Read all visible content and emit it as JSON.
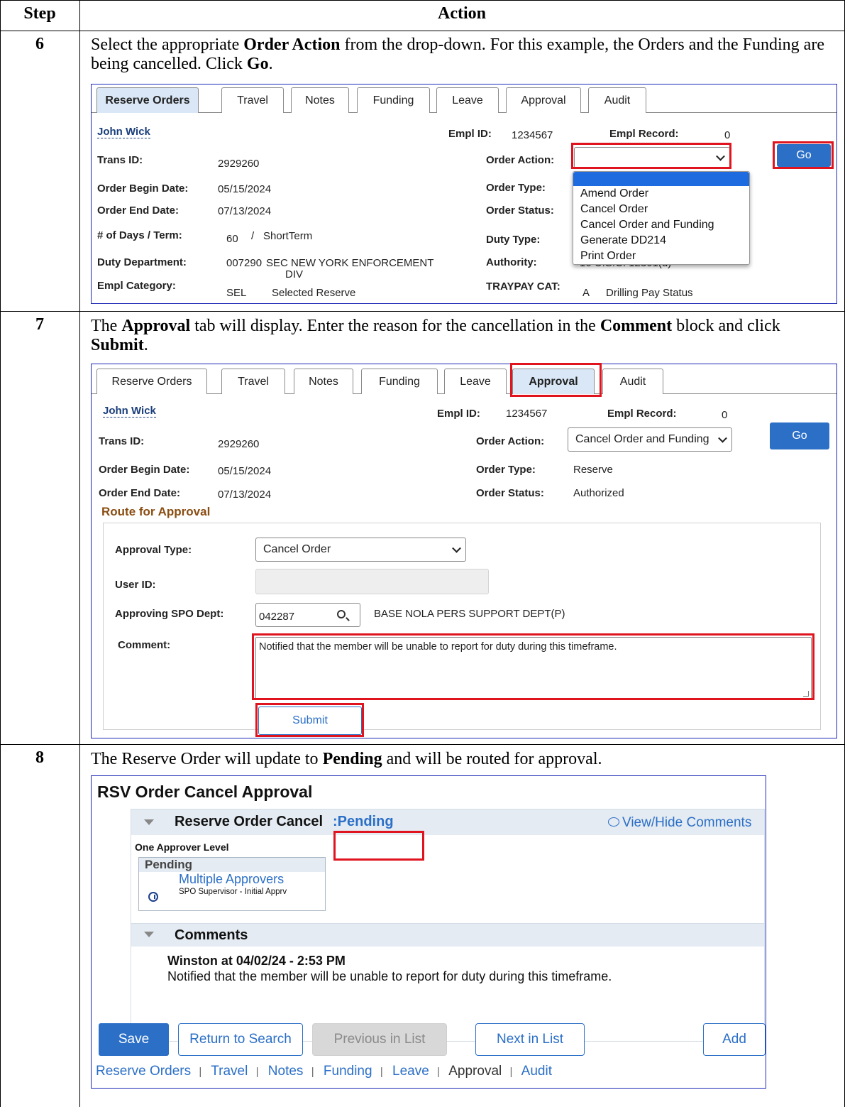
{
  "table": {
    "header_step": "Step",
    "header_action": "Action"
  },
  "step6": {
    "number": "6",
    "instr": {
      "t1": "Select the appropriate ",
      "b1": "Order Action",
      "t2": " from the drop-down. For this example, the Orders and the Funding are being cancelled. Click ",
      "b2": "Go",
      "t3": "."
    },
    "tabs": [
      "Reserve Orders",
      "Travel",
      "Notes",
      "Funding",
      "Leave",
      "Approval",
      "Audit"
    ],
    "name": "John Wick",
    "empl_id_label": "Empl ID:",
    "empl_id": "1234567",
    "empl_record_label": "Empl Record:",
    "empl_record": "0",
    "trans_id_label": "Trans ID:",
    "trans_id": "2929260",
    "order_action_label": "Order Action:",
    "order_action_value": "",
    "go_label": "Go",
    "begin_label": "Order Begin Date:",
    "begin": "05/15/2024",
    "end_label": "Order End Date:",
    "end": "07/13/2024",
    "type_label": "Order Type:",
    "status_label": "Order Status:",
    "days_label": "# of Days / Term:",
    "days": "60",
    "term_sep": "/",
    "term": "ShortTerm",
    "duty_type_label": "Duty Type:",
    "dept_label": "Duty Department:",
    "dept_code": "007290",
    "dept_name_1": "SEC NEW YORK ENFORCEMENT",
    "dept_name_2": "DIV",
    "authority_label": "Authority:",
    "authority_value": "10 U.S.C. 12301(d)",
    "category_label": "Empl Category:",
    "category_code": "SEL",
    "category_name": "Selected Reserve",
    "traypay_label": "TRAYPAY CAT:",
    "traypay_code": "A",
    "traypay_name": "Drilling Pay Status",
    "dropdown_options": [
      "Amend Order",
      "Cancel Order",
      "Cancel Order and Funding",
      "Generate DD214",
      "Print Order"
    ]
  },
  "step7": {
    "number": "7",
    "instr": {
      "t1": "The ",
      "b1": "Approval",
      "t2": " tab will display. Enter the reason for the cancellation in the ",
      "b2": "Comment",
      "t3": " block and click ",
      "b3": "Submit",
      "t4": "."
    },
    "tabs": [
      "Reserve Orders",
      "Travel",
      "Notes",
      "Funding",
      "Leave",
      "Approval",
      "Audit"
    ],
    "name": "John Wick",
    "empl_id_label": "Empl ID:",
    "empl_id": "1234567",
    "empl_record_label": "Empl Record:",
    "empl_record": "0",
    "trans_id_label": "Trans ID:",
    "trans_id": "2929260",
    "order_action_label": "Order Action:",
    "order_action_value": "Cancel Order and Funding",
    "go_label": "Go",
    "begin_label": "Order Begin Date:",
    "begin": "05/15/2024",
    "end_label": "Order End Date:",
    "end": "07/13/2024",
    "type_label": "Order Type:",
    "type": "Reserve",
    "status_label": "Order Status:",
    "status": "Authorized",
    "route_title": "Route for Approval",
    "approval_type_label": "Approval Type:",
    "approval_type": "Cancel Order",
    "user_id_label": "User ID:",
    "user_id": "",
    "spo_label": "Approving SPO Dept:",
    "spo_code": "042287",
    "spo_name": "BASE NOLA PERS SUPPORT DEPT(P)",
    "comment_label": "Comment:",
    "comment": "Notified that the member will be unable to report for duty during this timeframe.",
    "submit_label": "Submit"
  },
  "step8": {
    "number": "8",
    "instr": {
      "t1": "The Reserve Order will update to ",
      "b1": "Pending",
      "t2": " and will be routed for approval."
    },
    "title": "RSV Order Cancel Approval",
    "section_title": "Reserve Order Cancel",
    "section_status": ":Pending",
    "view_hide": "View/Hide Comments",
    "level": "One Approver Level",
    "card_status": "Pending",
    "card_link": "Multiple Approvers",
    "card_role": "SPO Supervisor - Initial Apprv",
    "comments_title": "Comments",
    "comment_author": "Winston at 04/02/24 - 2:53 PM",
    "comment_text": "Notified that the member will be unable to report for duty during this timeframe.",
    "buttons": {
      "save": "Save",
      "return": "Return to Search",
      "previous": "Previous in List",
      "next": "Next in List",
      "add": "Add"
    },
    "links": [
      "Reserve Orders",
      "Travel",
      "Notes",
      "Funding",
      "Leave",
      "Approval",
      "Audit"
    ],
    "link_sep": "|"
  }
}
